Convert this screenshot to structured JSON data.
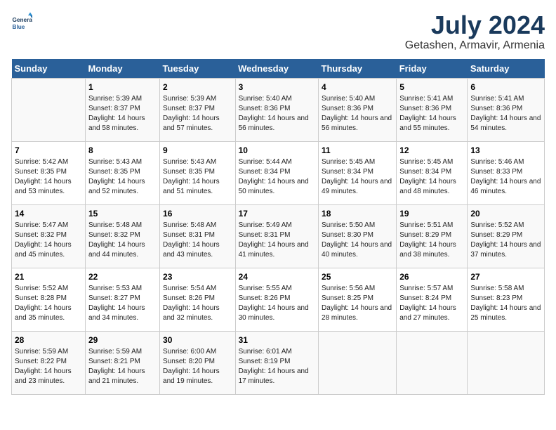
{
  "logo": {
    "line1": "General",
    "line2": "Blue"
  },
  "title": "July 2024",
  "subtitle": "Getashen, Armavir, Armenia",
  "header_days": [
    "Sunday",
    "Monday",
    "Tuesday",
    "Wednesday",
    "Thursday",
    "Friday",
    "Saturday"
  ],
  "weeks": [
    [
      {
        "day": "",
        "sunrise": "",
        "sunset": "",
        "daylight": ""
      },
      {
        "day": "1",
        "sunrise": "Sunrise: 5:39 AM",
        "sunset": "Sunset: 8:37 PM",
        "daylight": "Daylight: 14 hours and 58 minutes."
      },
      {
        "day": "2",
        "sunrise": "Sunrise: 5:39 AM",
        "sunset": "Sunset: 8:37 PM",
        "daylight": "Daylight: 14 hours and 57 minutes."
      },
      {
        "day": "3",
        "sunrise": "Sunrise: 5:40 AM",
        "sunset": "Sunset: 8:36 PM",
        "daylight": "Daylight: 14 hours and 56 minutes."
      },
      {
        "day": "4",
        "sunrise": "Sunrise: 5:40 AM",
        "sunset": "Sunset: 8:36 PM",
        "daylight": "Daylight: 14 hours and 56 minutes."
      },
      {
        "day": "5",
        "sunrise": "Sunrise: 5:41 AM",
        "sunset": "Sunset: 8:36 PM",
        "daylight": "Daylight: 14 hours and 55 minutes."
      },
      {
        "day": "6",
        "sunrise": "Sunrise: 5:41 AM",
        "sunset": "Sunset: 8:36 PM",
        "daylight": "Daylight: 14 hours and 54 minutes."
      }
    ],
    [
      {
        "day": "7",
        "sunrise": "Sunrise: 5:42 AM",
        "sunset": "Sunset: 8:35 PM",
        "daylight": "Daylight: 14 hours and 53 minutes."
      },
      {
        "day": "8",
        "sunrise": "Sunrise: 5:43 AM",
        "sunset": "Sunset: 8:35 PM",
        "daylight": "Daylight: 14 hours and 52 minutes."
      },
      {
        "day": "9",
        "sunrise": "Sunrise: 5:43 AM",
        "sunset": "Sunset: 8:35 PM",
        "daylight": "Daylight: 14 hours and 51 minutes."
      },
      {
        "day": "10",
        "sunrise": "Sunrise: 5:44 AM",
        "sunset": "Sunset: 8:34 PM",
        "daylight": "Daylight: 14 hours and 50 minutes."
      },
      {
        "day": "11",
        "sunrise": "Sunrise: 5:45 AM",
        "sunset": "Sunset: 8:34 PM",
        "daylight": "Daylight: 14 hours and 49 minutes."
      },
      {
        "day": "12",
        "sunrise": "Sunrise: 5:45 AM",
        "sunset": "Sunset: 8:34 PM",
        "daylight": "Daylight: 14 hours and 48 minutes."
      },
      {
        "day": "13",
        "sunrise": "Sunrise: 5:46 AM",
        "sunset": "Sunset: 8:33 PM",
        "daylight": "Daylight: 14 hours and 46 minutes."
      }
    ],
    [
      {
        "day": "14",
        "sunrise": "Sunrise: 5:47 AM",
        "sunset": "Sunset: 8:32 PM",
        "daylight": "Daylight: 14 hours and 45 minutes."
      },
      {
        "day": "15",
        "sunrise": "Sunrise: 5:48 AM",
        "sunset": "Sunset: 8:32 PM",
        "daylight": "Daylight: 14 hours and 44 minutes."
      },
      {
        "day": "16",
        "sunrise": "Sunrise: 5:48 AM",
        "sunset": "Sunset: 8:31 PM",
        "daylight": "Daylight: 14 hours and 43 minutes."
      },
      {
        "day": "17",
        "sunrise": "Sunrise: 5:49 AM",
        "sunset": "Sunset: 8:31 PM",
        "daylight": "Daylight: 14 hours and 41 minutes."
      },
      {
        "day": "18",
        "sunrise": "Sunrise: 5:50 AM",
        "sunset": "Sunset: 8:30 PM",
        "daylight": "Daylight: 14 hours and 40 minutes."
      },
      {
        "day": "19",
        "sunrise": "Sunrise: 5:51 AM",
        "sunset": "Sunset: 8:29 PM",
        "daylight": "Daylight: 14 hours and 38 minutes."
      },
      {
        "day": "20",
        "sunrise": "Sunrise: 5:52 AM",
        "sunset": "Sunset: 8:29 PM",
        "daylight": "Daylight: 14 hours and 37 minutes."
      }
    ],
    [
      {
        "day": "21",
        "sunrise": "Sunrise: 5:52 AM",
        "sunset": "Sunset: 8:28 PM",
        "daylight": "Daylight: 14 hours and 35 minutes."
      },
      {
        "day": "22",
        "sunrise": "Sunrise: 5:53 AM",
        "sunset": "Sunset: 8:27 PM",
        "daylight": "Daylight: 14 hours and 34 minutes."
      },
      {
        "day": "23",
        "sunrise": "Sunrise: 5:54 AM",
        "sunset": "Sunset: 8:26 PM",
        "daylight": "Daylight: 14 hours and 32 minutes."
      },
      {
        "day": "24",
        "sunrise": "Sunrise: 5:55 AM",
        "sunset": "Sunset: 8:26 PM",
        "daylight": "Daylight: 14 hours and 30 minutes."
      },
      {
        "day": "25",
        "sunrise": "Sunrise: 5:56 AM",
        "sunset": "Sunset: 8:25 PM",
        "daylight": "Daylight: 14 hours and 28 minutes."
      },
      {
        "day": "26",
        "sunrise": "Sunrise: 5:57 AM",
        "sunset": "Sunset: 8:24 PM",
        "daylight": "Daylight: 14 hours and 27 minutes."
      },
      {
        "day": "27",
        "sunrise": "Sunrise: 5:58 AM",
        "sunset": "Sunset: 8:23 PM",
        "daylight": "Daylight: 14 hours and 25 minutes."
      }
    ],
    [
      {
        "day": "28",
        "sunrise": "Sunrise: 5:59 AM",
        "sunset": "Sunset: 8:22 PM",
        "daylight": "Daylight: 14 hours and 23 minutes."
      },
      {
        "day": "29",
        "sunrise": "Sunrise: 5:59 AM",
        "sunset": "Sunset: 8:21 PM",
        "daylight": "Daylight: 14 hours and 21 minutes."
      },
      {
        "day": "30",
        "sunrise": "Sunrise: 6:00 AM",
        "sunset": "Sunset: 8:20 PM",
        "daylight": "Daylight: 14 hours and 19 minutes."
      },
      {
        "day": "31",
        "sunrise": "Sunrise: 6:01 AM",
        "sunset": "Sunset: 8:19 PM",
        "daylight": "Daylight: 14 hours and 17 minutes."
      },
      {
        "day": "",
        "sunrise": "",
        "sunset": "",
        "daylight": ""
      },
      {
        "day": "",
        "sunrise": "",
        "sunset": "",
        "daylight": ""
      },
      {
        "day": "",
        "sunrise": "",
        "sunset": "",
        "daylight": ""
      }
    ]
  ]
}
